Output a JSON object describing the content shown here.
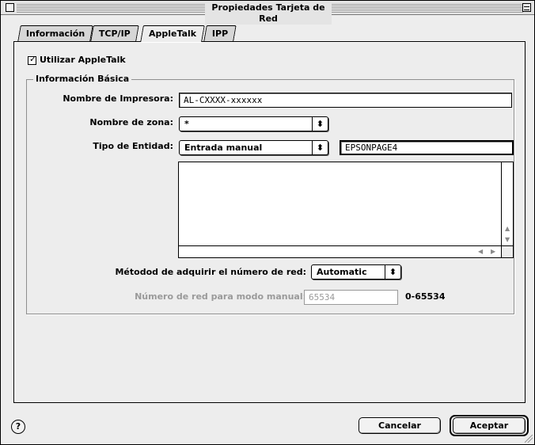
{
  "window": {
    "title": "Propiedades Tarjeta de Red"
  },
  "tabs": [
    {
      "label": "Información",
      "active": false
    },
    {
      "label": "TCP/IP",
      "active": false
    },
    {
      "label": "AppleTalk",
      "active": true
    },
    {
      "label": "IPP",
      "active": false
    }
  ],
  "appletalk": {
    "use_checkbox": {
      "label": "Utilizar AppleTalk",
      "checked": true,
      "mark": "✓"
    },
    "group_title": "Información Básica",
    "printer_name": {
      "label": "Nombre de Impresora:",
      "value": "AL-CXXXX-xxxxxx"
    },
    "zone": {
      "label": "Nombre de zona:",
      "value": "*"
    },
    "entity": {
      "label": "Tipo de Entidad:",
      "value": "Entrada manual",
      "text_value": "EPSONPAGE4"
    },
    "network_method": {
      "label": "Métodod de adquirir el número de red:",
      "value": "Automatic"
    },
    "manual_network": {
      "label": "Número de red para modo manual:",
      "value": "65534",
      "range": "0-65534"
    }
  },
  "buttons": {
    "cancel": "Cancelar",
    "accept": "Aceptar",
    "help": "?"
  },
  "icons": {
    "popup_arrows": "⬍",
    "scroll_up": "▲",
    "scroll_down": "▼",
    "scroll_left": "◀",
    "scroll_right": "▶"
  },
  "colors": {
    "window_bg": "#ededed",
    "disabled_text": "#9a9a9a"
  }
}
